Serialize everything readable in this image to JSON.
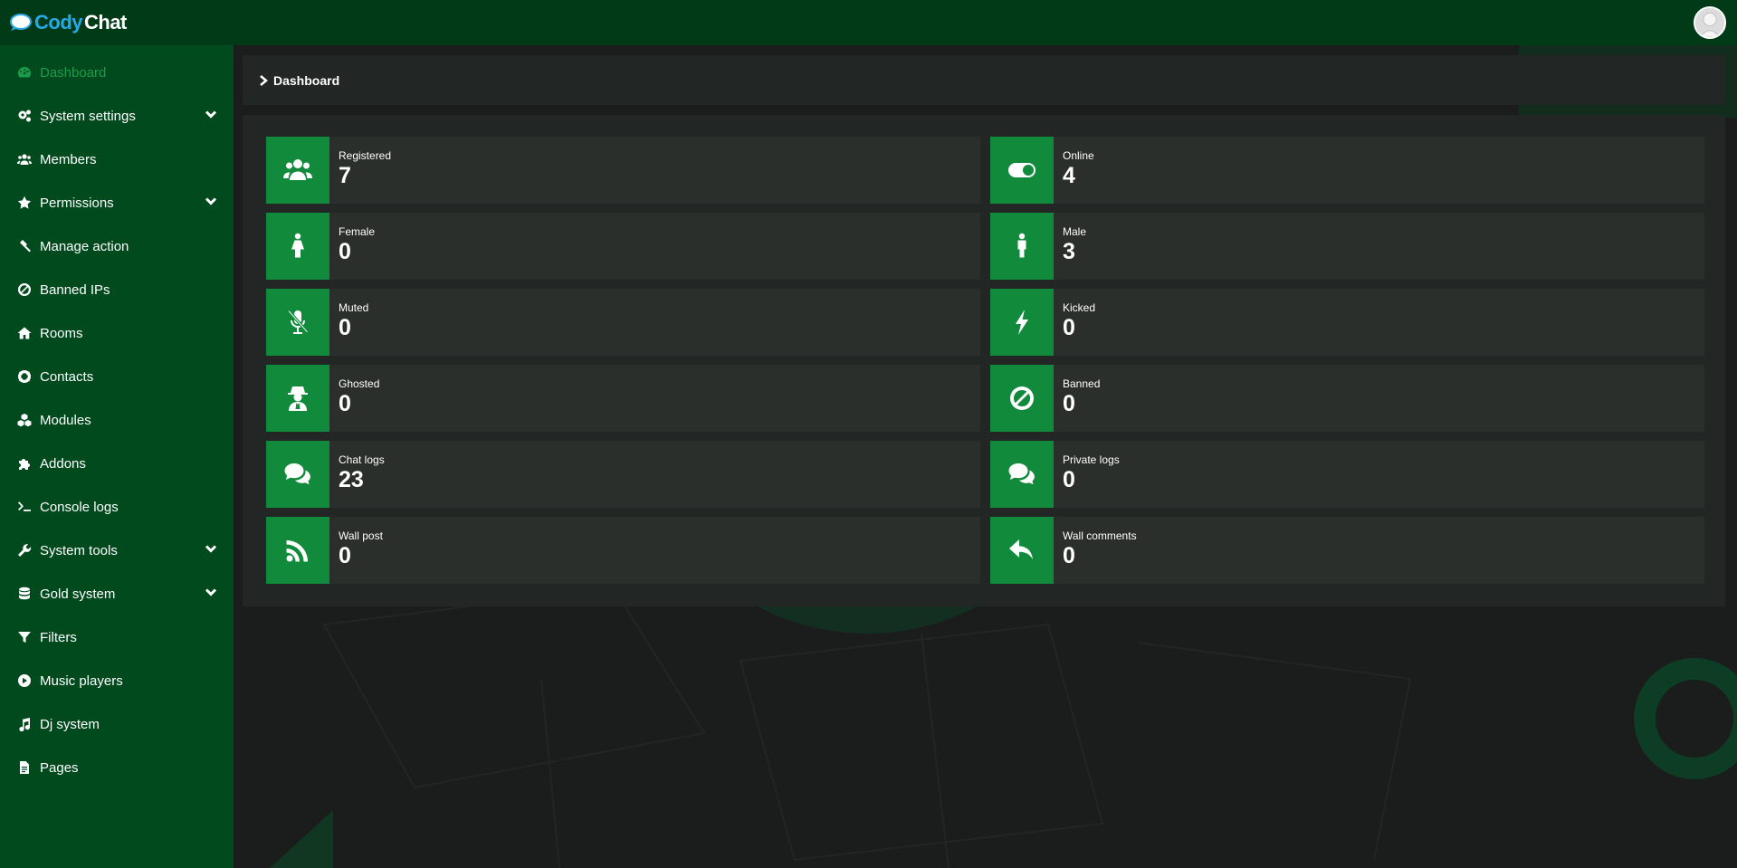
{
  "app": {
    "logo_part1": "Cody",
    "logo_part2": "Chat"
  },
  "sidebar": {
    "items": [
      {
        "label": "Dashboard",
        "icon": "dashboard-icon",
        "active": true
      },
      {
        "label": "System settings",
        "icon": "gears-icon",
        "dropdown": true
      },
      {
        "label": "Members",
        "icon": "users-icon"
      },
      {
        "label": "Permissions",
        "icon": "star-icon",
        "dropdown": true
      },
      {
        "label": "Manage action",
        "icon": "gavel-icon"
      },
      {
        "label": "Banned IPs",
        "icon": "ban-icon"
      },
      {
        "label": "Rooms",
        "icon": "home-icon"
      },
      {
        "label": "Contacts",
        "icon": "lifebuoy-icon"
      },
      {
        "label": "Modules",
        "icon": "cubes-icon"
      },
      {
        "label": "Addons",
        "icon": "puzzle-icon"
      },
      {
        "label": "Console logs",
        "icon": "terminal-icon"
      },
      {
        "label": "System tools",
        "icon": "wrench-icon",
        "dropdown": true
      },
      {
        "label": "Gold system",
        "icon": "database-icon",
        "dropdown": true
      },
      {
        "label": "Filters",
        "icon": "filter-icon"
      },
      {
        "label": "Music players",
        "icon": "play-circle-icon"
      },
      {
        "label": "Dj system",
        "icon": "music-icon"
      },
      {
        "label": "Pages",
        "icon": "file-icon"
      }
    ]
  },
  "breadcrumb": {
    "label": "Dashboard"
  },
  "stats": [
    {
      "label": "Registered",
      "value": "7",
      "icon": "users-icon"
    },
    {
      "label": "Online",
      "value": "4",
      "icon": "toggle-on-icon"
    },
    {
      "label": "Female",
      "value": "0",
      "icon": "female-icon"
    },
    {
      "label": "Male",
      "value": "3",
      "icon": "male-icon"
    },
    {
      "label": "Muted",
      "value": "0",
      "icon": "microphone-slash-icon"
    },
    {
      "label": "Kicked",
      "value": "0",
      "icon": "bolt-icon"
    },
    {
      "label": "Ghosted",
      "value": "0",
      "icon": "user-secret-icon"
    },
    {
      "label": "Banned",
      "value": "0",
      "icon": "ban-icon"
    },
    {
      "label": "Chat logs",
      "value": "23",
      "icon": "comments-icon"
    },
    {
      "label": "Private logs",
      "value": "0",
      "icon": "comments-icon"
    },
    {
      "label": "Wall post",
      "value": "0",
      "icon": "rss-icon"
    },
    {
      "label": "Wall comments",
      "value": "0",
      "icon": "reply-icon"
    }
  ],
  "colors": {
    "topbar": "#003a17",
    "sidebar": "#004a1e",
    "accent": "#128a3c",
    "active_text": "#1a9d4a",
    "panel": "#222725",
    "card": "#2a2f2c"
  }
}
